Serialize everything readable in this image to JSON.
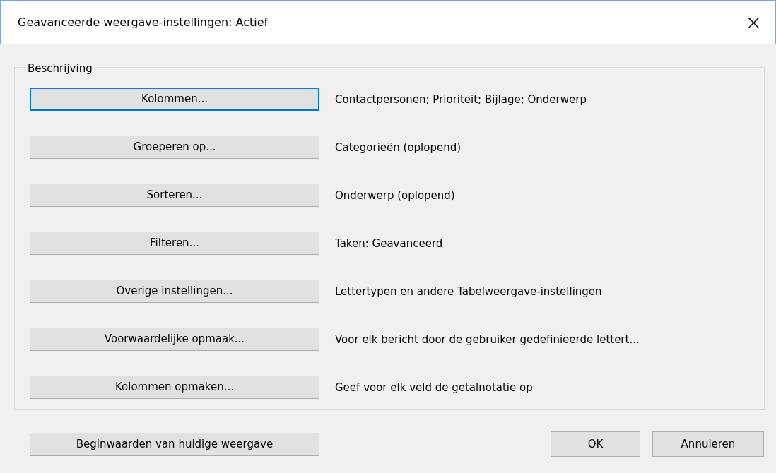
{
  "window": {
    "title": "Geavanceerde weergave-instellingen: Actief",
    "close": "×"
  },
  "group": {
    "label": "Beschrijving",
    "rows": [
      {
        "button": "Kolommen...",
        "focused": true,
        "description": "Contactpersonen; Prioriteit; Bijlage; Onderwerp"
      },
      {
        "button": "Groeperen op...",
        "focused": false,
        "description": "Categorieën (oplopend)"
      },
      {
        "button": "Sorteren...",
        "focused": false,
        "description": "Onderwerp (oplopend)"
      },
      {
        "button": "Filteren...",
        "focused": false,
        "description": "Taken: Geavanceerd"
      },
      {
        "button": "Overige instellingen...",
        "focused": false,
        "description": "Lettertypen en andere Tabelweergave-instellingen"
      },
      {
        "button": "Voorwaardelijke opmaak...",
        "focused": false,
        "description": "Voor elk bericht door de gebruiker gedefinieerde lettert..."
      },
      {
        "button": "Kolommen opmaken...",
        "focused": false,
        "description": "Geef voor elk veld de getalnotatie op"
      }
    ]
  },
  "footer": {
    "reset_button": "Beginwaarden van huidige weergave",
    "ok_button": "OK",
    "cancel_button": "Annuleren"
  }
}
